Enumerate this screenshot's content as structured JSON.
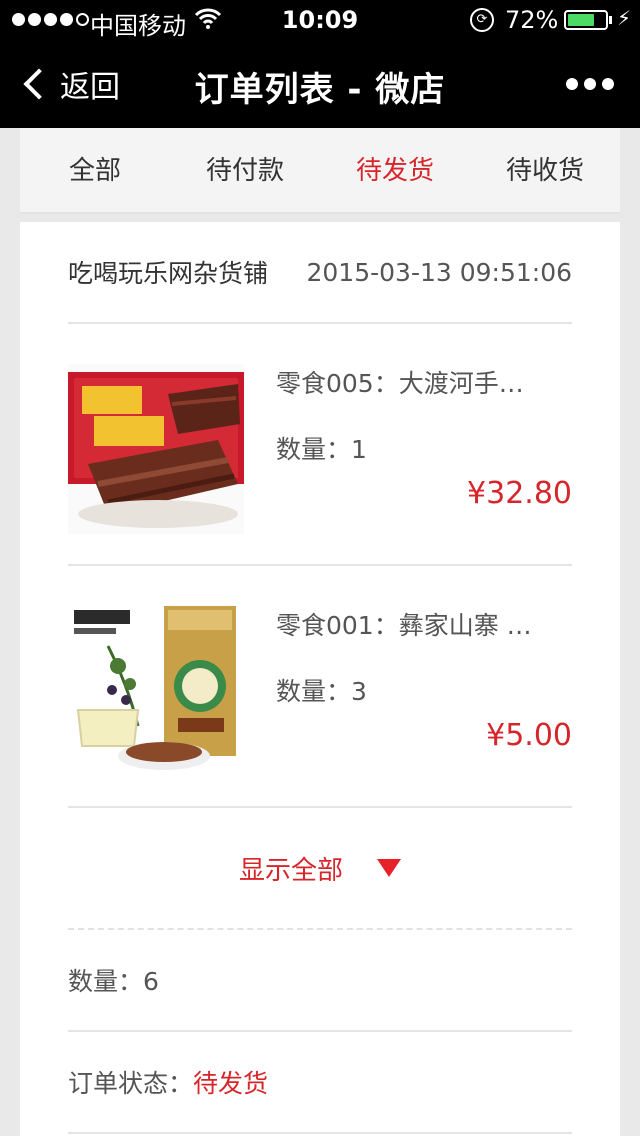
{
  "status_bar": {
    "carrier": "中国移动",
    "time": "10:09",
    "battery": "72%",
    "battery_level": 0.72
  },
  "nav": {
    "back_label": "返回",
    "title": "订单列表 - 微店"
  },
  "tabs": [
    {
      "label": "全部",
      "active": false
    },
    {
      "label": "待付款",
      "active": false
    },
    {
      "label": "待发货",
      "active": true
    },
    {
      "label": "待收货",
      "active": false
    }
  ],
  "order": {
    "shop_name": "吃喝玩乐网杂货铺",
    "time": "2015-03-13 09:51:06",
    "items": [
      {
        "name": "零食005：大渡河手…",
        "qty_label": "数量：1",
        "price": "¥32.80"
      },
      {
        "name": "零食001：彝家山寨 …",
        "qty_label": "数量：3",
        "price": "¥5.00"
      }
    ],
    "show_all_label": "显示全部",
    "total_qty_label": "数量：6",
    "status_label": "订单状态：",
    "status_value": "待发货"
  },
  "colors": {
    "accent": "#d7262b",
    "nav_bg": "#000000",
    "page_bg": "#e9e9e9"
  }
}
